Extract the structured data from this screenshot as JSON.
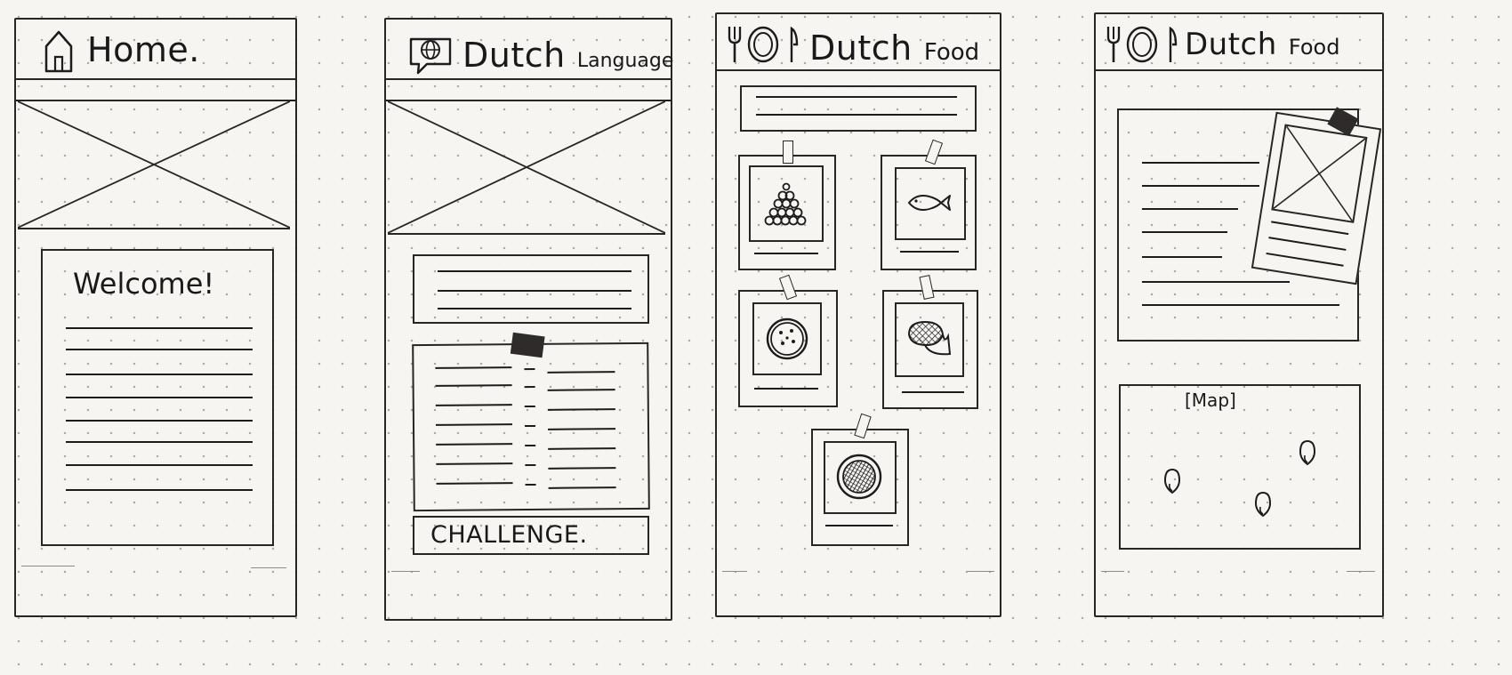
{
  "screens": [
    {
      "header": {
        "title": "Home.",
        "icon": "house-icon"
      },
      "welcome": {
        "heading": "Welcome!"
      }
    },
    {
      "header": {
        "title": "Dutch",
        "subtitle": "Language",
        "icon": "globe-chat-icon"
      },
      "challenge": {
        "label": "CHALLENGE."
      }
    },
    {
      "header": {
        "title": "Dutch",
        "subtitle": "Food",
        "icon": "fork-plate-knife-icon"
      },
      "food_cards": [
        {
          "icon": "pile-of-balls-icon"
        },
        {
          "icon": "fish-icon"
        },
        {
          "icon": "cookie-icon"
        },
        {
          "icon": "waffle-icon"
        },
        {
          "icon": "dish-icon"
        }
      ]
    },
    {
      "header": {
        "title": "Dutch",
        "subtitle": "Food",
        "icon": "fork-plate-knife-icon"
      },
      "map": {
        "label": "[Map]",
        "pins": 3,
        "pin_icon": "map-pin-icon"
      }
    }
  ]
}
